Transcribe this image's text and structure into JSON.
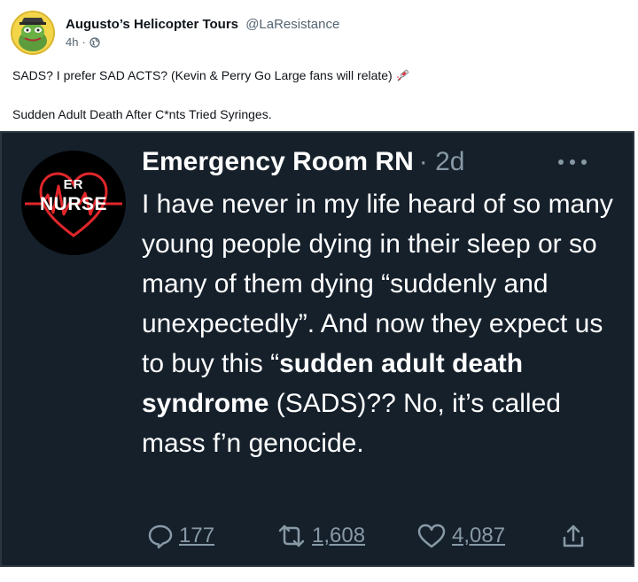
{
  "post": {
    "display_name": "Augusto’s Helicopter Tours",
    "handle": "@LaResistance",
    "time": "4h",
    "separator": "·",
    "line1": "SADS? I prefer SAD ACTS? (Kevin & Perry Go Large fans will relate)",
    "line2": "Sudden Adult Death After C*nts Tried Syringes."
  },
  "embedded_tweet": {
    "avatar_top": "ER",
    "avatar_bottom": "NURSE",
    "name": "Emergency Room RN",
    "time": "· 2d",
    "body_part1": "I have never in my life heard of so many young people dying in their sleep or so many of them dying “suddenly and unexpectedly”. And now they expect us to buy this “",
    "body_bold1": "sudden adult death syndrome",
    "body_part2": " (SADS)?? No, it’s called mass f’n genocide.",
    "replies": "177",
    "retweets": "1,608",
    "likes": "4,087"
  },
  "icons": {
    "globe": "globe-icon",
    "syringe": "syringe-emoji",
    "more": "more-dots-icon",
    "reply": "reply-icon",
    "retweet": "retweet-icon",
    "like": "heart-icon",
    "share": "share-icon"
  },
  "colors": {
    "embed_background": "#15202b",
    "muted": "#8899a6",
    "nurse_red": "#e0262b"
  }
}
